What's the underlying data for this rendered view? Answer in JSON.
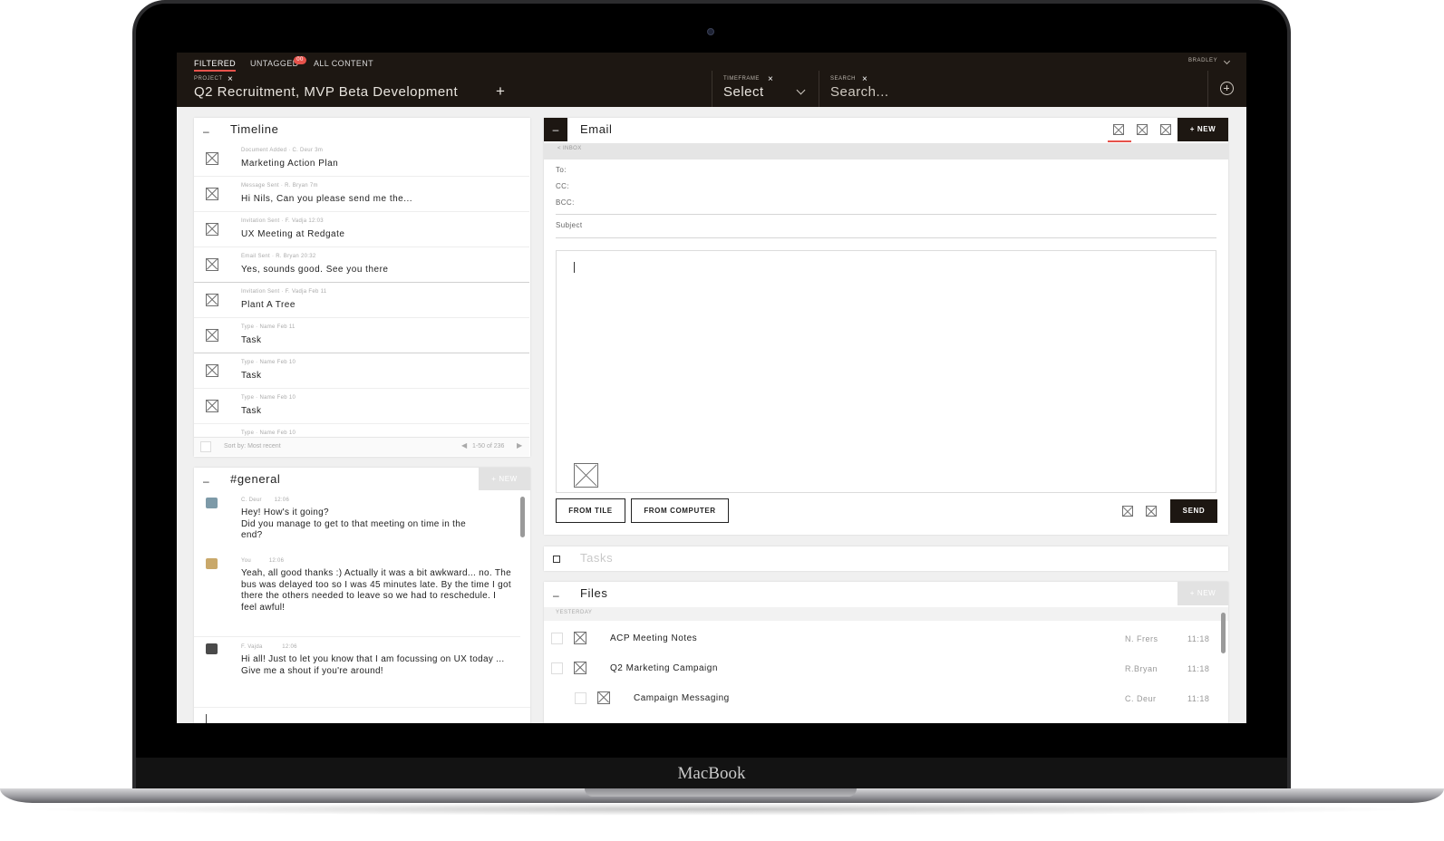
{
  "device": {
    "brand_label": "MacBook"
  },
  "topbar": {
    "tabs": [
      {
        "label": "FILTERED",
        "active": true
      },
      {
        "label": "UNTAGGED",
        "badge": "00"
      },
      {
        "label": "ALL CONTENT"
      }
    ],
    "project": {
      "label": "PROJECT",
      "value": "Q2 Recruitment, MVP Beta Development"
    },
    "timeframe": {
      "label": "TIMEFRAME",
      "value": "Select"
    },
    "search": {
      "label": "SEARCH",
      "placeholder": "Search..."
    },
    "user": "BRADLEY"
  },
  "timeline": {
    "title": "Timeline",
    "items": [
      {
        "meta": "Document Added · C. Deur   3m",
        "text": "Marketing Action Plan"
      },
      {
        "meta": "Message Sent · R. Bryan   7m",
        "text": "Hi Nils, Can you please send me the..."
      },
      {
        "meta": "Invitation Sent · F. Vadja   12:03",
        "text": "UX Meeting at Redgate"
      },
      {
        "meta": "Email Sent · R. Bryan   20:32",
        "text": "Yes, sounds good. See you there"
      },
      {
        "meta": "Invitation Sent · F. Vadja   Feb 11",
        "text": "Plant A Tree"
      },
      {
        "meta": "Type · Name   Feb 11",
        "text": "Task"
      },
      {
        "meta": "Type · Name   Feb 10",
        "text": "Task"
      },
      {
        "meta": "Type · Name   Feb 10",
        "text": "Task"
      },
      {
        "meta": "Type · Name   Feb 10",
        "text": ""
      }
    ],
    "sort_label": "Sort by: Most recent",
    "pagination": "1-50 of 236"
  },
  "chat": {
    "title": "#general",
    "new_label": "+ NEW",
    "messages": [
      {
        "author": "C. Deur",
        "time": "12:06",
        "body": "Hey! How's it going?\nDid you manage to get to that meeting on time in the\nend?",
        "avatar_color": "#7d9aa8"
      },
      {
        "author": "You",
        "time": "12:06",
        "body": "Yeah, all good thanks :)\nActually it was a bit awkward... no. The bus was delayed too so I was 45 minutes late. By the time I got there the others needed to leave so we had to reschedule. I feel awful!",
        "avatar_color": "#c9a86a"
      },
      {
        "author": "F. Vajda",
        "time": "12:06",
        "body": "Hi all! Just to let you know that I am focussing on UX today ... Give me a shout if you're around!",
        "avatar_color": "#4a4a4a"
      }
    ]
  },
  "email": {
    "title": "Email",
    "new_label": "+ NEW",
    "breadcrumb": "< INBOX",
    "to_label": "To:",
    "cc_label": "CC:",
    "bcc_label": "BCC:",
    "subject_label": "Subject",
    "from_tile_label": "FROM TILE",
    "from_computer_label": "FROM COMPUTER",
    "send_label": "SEND"
  },
  "tasks": {
    "title": "Tasks"
  },
  "files": {
    "title": "Files",
    "new_label": "+ NEW",
    "group_label": "YESTERDAY",
    "items": [
      {
        "name": "ACP Meeting Notes",
        "owner": "N. Frers",
        "time": "11:18",
        "indent": 0
      },
      {
        "name": "Q2 Marketing Campaign",
        "owner": "R.Bryan",
        "time": "11:18",
        "indent": 0
      },
      {
        "name": "Campaign Messaging",
        "owner": "C. Deur",
        "time": "11:18",
        "indent": 1
      }
    ]
  },
  "colors": {
    "accent": "#e6524b",
    "dark": "#1d1712",
    "muted_button": "#e2e2e2"
  }
}
